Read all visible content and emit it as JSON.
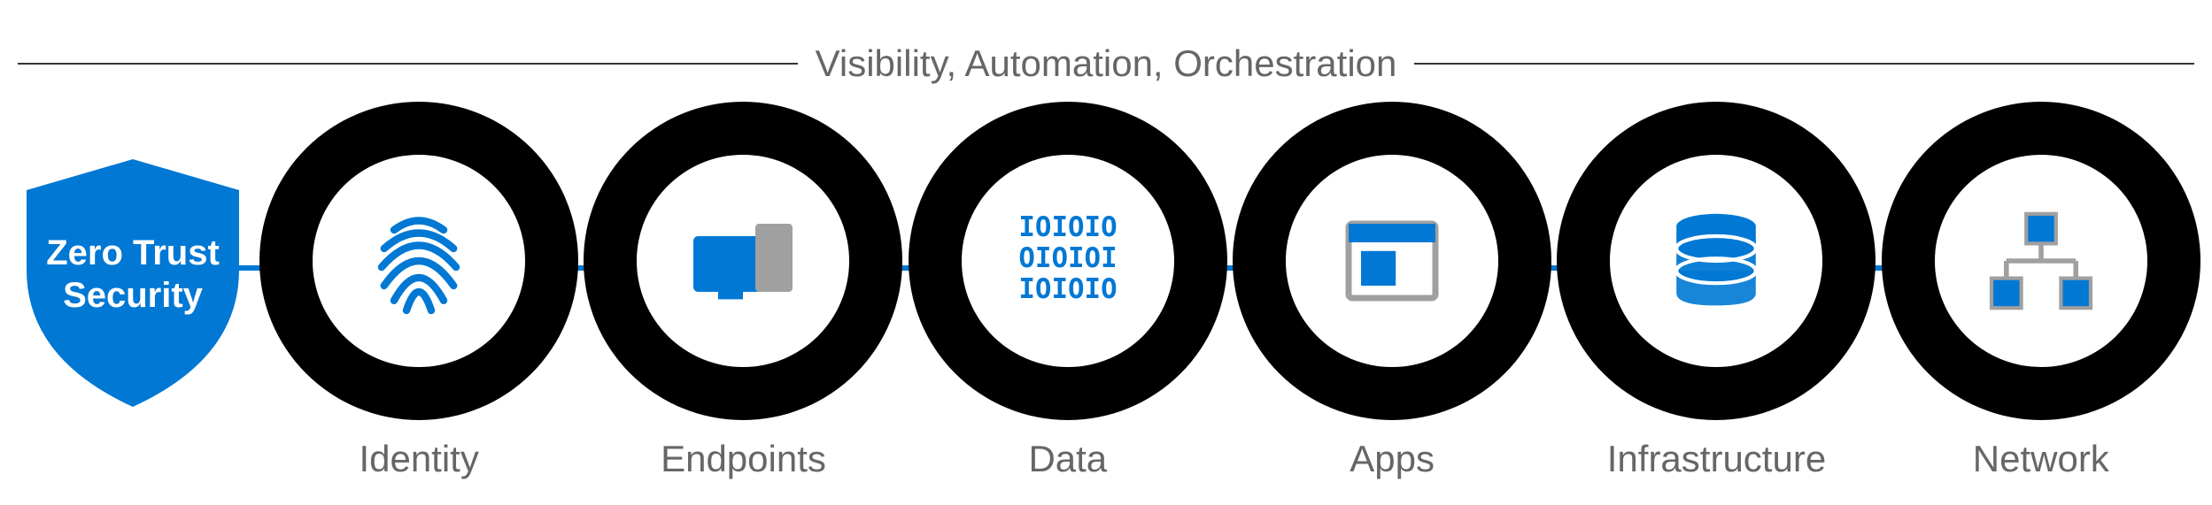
{
  "header": {
    "title": "Visibility, Automation, Orchestration"
  },
  "shield": {
    "label": "Zero Trust\nSecurity"
  },
  "pillars": [
    {
      "label": "Identity",
      "icon": "fingerprint-icon"
    },
    {
      "label": "Endpoints",
      "icon": "devices-icon"
    },
    {
      "label": "Data",
      "icon": "binary-data-icon"
    },
    {
      "label": "Apps",
      "icon": "app-window-icon"
    },
    {
      "label": "Infrastructure",
      "icon": "database-icon"
    },
    {
      "label": "Network",
      "icon": "network-nodes-icon"
    }
  ],
  "colors": {
    "accent": "#0078d4",
    "text": "#666",
    "ring": "#000",
    "secondary": "#a0a0a0"
  }
}
